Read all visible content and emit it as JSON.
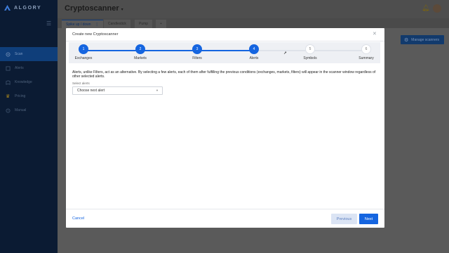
{
  "app": {
    "brand": "ALGORY",
    "title": "Cryptoscanner",
    "title_caret": "▾"
  },
  "sidebar": {
    "items": [
      {
        "label": "Scan",
        "icon": "scan-icon",
        "active": true
      },
      {
        "label": "Alerts",
        "icon": "alerts-icon"
      },
      {
        "label": "Knowledge",
        "icon": "knowledge-icon"
      },
      {
        "label": "Pricing",
        "icon": "crown-icon"
      },
      {
        "label": "Manual",
        "icon": "manual-icon"
      }
    ]
  },
  "tabs": [
    {
      "label": "Spike up / down",
      "menu": "⋮",
      "active": true
    },
    {
      "label": "Candlestick"
    },
    {
      "label": "Pump"
    },
    {
      "label": "+"
    }
  ],
  "toolbar": {
    "manage_label": "Manage scanners"
  },
  "modal": {
    "title": "Create new Cryptoscanner",
    "close": "✕",
    "steps": [
      {
        "number": "1",
        "label": "Exchanges",
        "status": "done"
      },
      {
        "number": "2",
        "label": "Markets",
        "status": "done"
      },
      {
        "number": "3",
        "label": "Filters",
        "status": "done"
      },
      {
        "number": "4",
        "label": "Alerts",
        "status": "current"
      },
      {
        "number": "5",
        "label": "Symbols",
        "status": "todo"
      },
      {
        "number": "6",
        "label": "Summary",
        "status": "todo"
      }
    ],
    "description": "Alerts, unlike Filters, act as an alternative. By selecting a few alerts, each of them after fulfilling the previous conditions (exchanges, markets, filters) will appear in the scanner window regardless of other selected alerts.",
    "field_label": "Select alerts",
    "select_value": "Choose next alert",
    "cancel_label": "Cancel",
    "previous_label": "Previous",
    "next_label": "Next"
  },
  "colors": {
    "accent": "#1565e0",
    "sidebar_bg": "#0b1b33",
    "overlay_bg": "#5a5a5a"
  }
}
